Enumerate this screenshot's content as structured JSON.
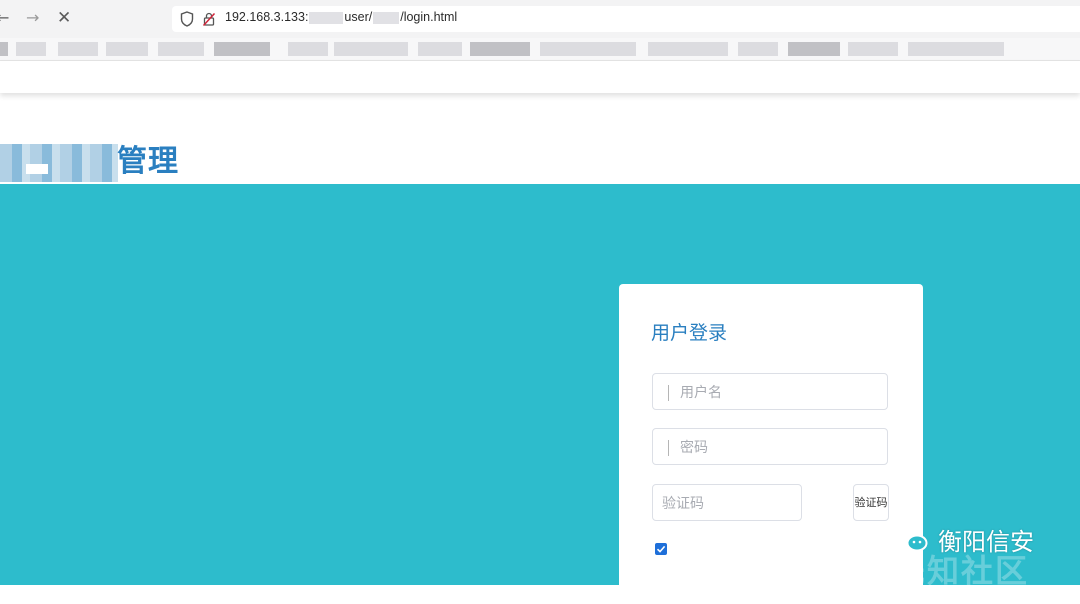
{
  "browser": {
    "nav": {
      "back_glyph": "←",
      "forward_glyph": "→",
      "stop_glyph": "✕"
    },
    "url": {
      "host": "192.168.3.133:",
      "mid": "user/",
      "end": "/login.html"
    },
    "icons": [
      "shield-icon",
      "lock-icon"
    ]
  },
  "site": {
    "logo_text_visible": "管理"
  },
  "login": {
    "title": "用户登录",
    "username_placeholder": "用户名",
    "password_placeholder": "密码",
    "captcha_placeholder": "验证码",
    "captcha_button": "验证码",
    "remember_checked": true
  },
  "watermark": {
    "text": "衡阳信安",
    "ghost_text": "先知社区",
    "icon": "wechat-icon"
  },
  "colors": {
    "teal": "#2dbccc",
    "brand_blue": "#2a7fc0",
    "checkbox_blue": "#1e6fd9"
  }
}
